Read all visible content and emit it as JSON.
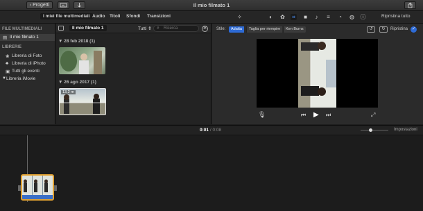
{
  "window": {
    "title": "Il mio filmato 1",
    "back_label": "Progetti"
  },
  "toolbar": {
    "tabs": [
      {
        "label": "I miei file multimediali",
        "selected": true
      },
      {
        "label": "Audio",
        "selected": false
      },
      {
        "label": "Titoli",
        "selected": false
      },
      {
        "label": "Sfondi",
        "selected": false
      },
      {
        "label": "Transizioni",
        "selected": false
      }
    ],
    "restore_all": "Ripristina tutto"
  },
  "sidebar": {
    "media_header": "FILE MULTIMEDIALI",
    "project_item": "Il mio filmato 1",
    "libraries_header": "LIBRERIE",
    "items": [
      "Libreria di Foto",
      "Libreria di iPhoto",
      "Tutti gli eventi"
    ],
    "imovie_library": "Libreria iMovie"
  },
  "browser": {
    "project_title": "Il mio filmato 1",
    "filter": "Tutti",
    "search_placeholder": "Ricerca",
    "groups": [
      {
        "date": "28 feb 2018",
        "count": "(1)"
      },
      {
        "date": "26 ago 2017",
        "count": "(1)",
        "duration": "13,2 m"
      }
    ]
  },
  "viewer": {
    "style_label": "Stile:",
    "styles": [
      "Adatta",
      "Taglia per riempire",
      "Ken Burns"
    ],
    "selected_style": "Adatta",
    "restore": "Ripristina"
  },
  "timeline": {
    "current_time": "0:01",
    "separator": "/",
    "total_time": "0:08",
    "settings": "Impostazioni",
    "zoom_level": 0.35
  },
  "colors": {
    "accent": "#2e6bd6",
    "clip_border": "#e0a030",
    "selected_item": "#3a3a3a"
  }
}
